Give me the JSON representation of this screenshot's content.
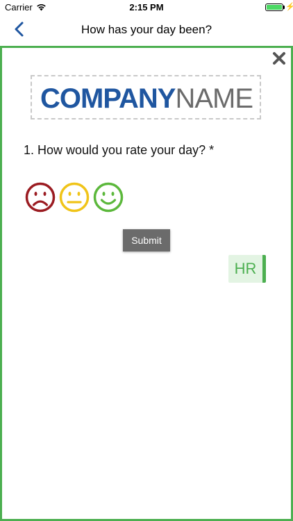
{
  "status_bar": {
    "carrier": "Carrier",
    "time": "2:15 PM",
    "wifi_icon": "wifi-icon",
    "battery_icon": "battery-full-icon",
    "battery_level": 1.0,
    "charging_icon": "bolt-icon",
    "charging_glyph": "⚡"
  },
  "nav": {
    "back_icon": "chevron-left-icon",
    "title": "How has your day been?"
  },
  "survey": {
    "close_icon": "close-icon",
    "logo": {
      "part1": "COMPANY",
      "part2": "NAME"
    },
    "question": "1. How would you rate your day? *",
    "ratings": [
      {
        "name": "sad-face-icon",
        "color": "#9b1c22"
      },
      {
        "name": "neutral-face-icon",
        "color": "#f0c419"
      },
      {
        "name": "happy-face-icon",
        "color": "#5cb83c"
      }
    ],
    "submit_label": "Submit",
    "badge": "HR"
  },
  "colors": {
    "frame_border": "#4caf50",
    "logo_blue": "#1f56a0",
    "logo_gray": "#6b6b6b",
    "back_arrow": "#1f56a0",
    "button_bg": "#6b6b6b",
    "badge_bg": "#e3f4e3",
    "badge_text": "#4caf50"
  }
}
